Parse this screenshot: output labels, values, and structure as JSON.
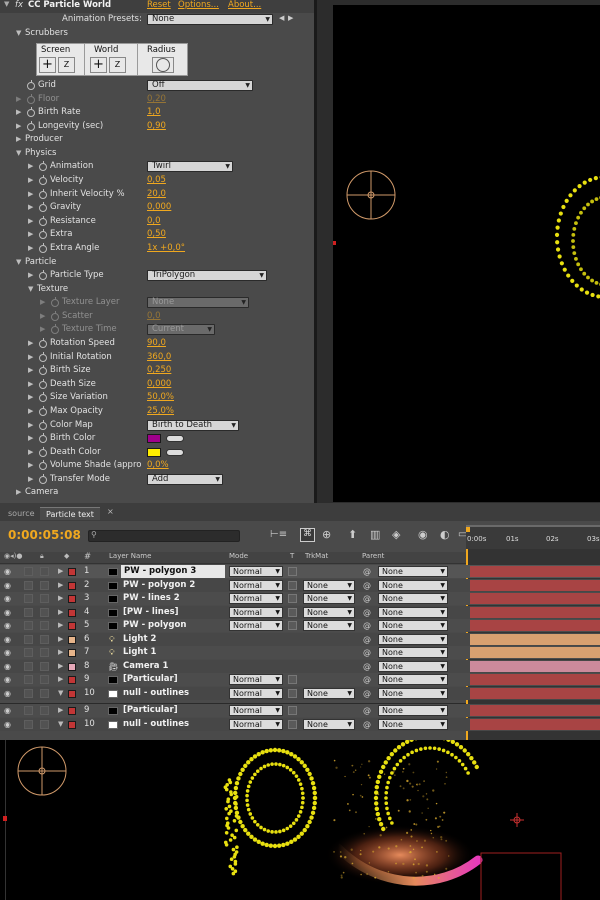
{
  "effect": {
    "fx_badge": "fx",
    "name": "CC Particle World",
    "links": [
      "Reset",
      "Options...",
      "About..."
    ],
    "presets_label": "Animation Presets:",
    "presets_value": "None"
  },
  "scrubbers": {
    "label": "Scrubbers",
    "screen": "Screen",
    "world": "World",
    "radius": "Radius",
    "z": "Z"
  },
  "properties": [
    {
      "label": "Grid",
      "kind": "dd",
      "value": "Off",
      "indent": 0
    },
    {
      "label": "Floor",
      "kind": "val",
      "value": "0,20",
      "indent": 0,
      "dim": true
    },
    {
      "label": "Birth Rate",
      "kind": "val",
      "value": "1,0",
      "indent": 0
    },
    {
      "label": "Longevity (sec)",
      "kind": "val",
      "value": "0,90",
      "indent": 0
    },
    {
      "label": "Producer",
      "kind": "group",
      "indent": 0
    },
    {
      "label": "Physics",
      "kind": "group",
      "indent": 0,
      "open": true
    },
    {
      "label": "Animation",
      "kind": "dd",
      "value": "Twirl",
      "indent": 1
    },
    {
      "label": "Velocity",
      "kind": "val",
      "value": "0,05",
      "indent": 1
    },
    {
      "label": "Inherit Velocity %",
      "kind": "val",
      "value": "20,0",
      "indent": 1
    },
    {
      "label": "Gravity",
      "kind": "val",
      "value": "0,000",
      "indent": 1
    },
    {
      "label": "Resistance",
      "kind": "val",
      "value": "0,0",
      "indent": 1
    },
    {
      "label": "Extra",
      "kind": "val",
      "value": "0,50",
      "indent": 1
    },
    {
      "label": "Extra Angle",
      "kind": "val",
      "value": "1x +0,0°",
      "indent": 1
    },
    {
      "label": "Particle",
      "kind": "group",
      "indent": 0,
      "open": true
    },
    {
      "label": "Particle Type",
      "kind": "dd",
      "value": "TriPolygon",
      "indent": 1
    },
    {
      "label": "Texture",
      "kind": "group",
      "indent": 1,
      "open": true
    },
    {
      "label": "Texture Layer",
      "kind": "dd",
      "value": "None",
      "indent": 2,
      "dim": true
    },
    {
      "label": "Scatter",
      "kind": "val",
      "value": "0,0",
      "indent": 2,
      "dim": true
    },
    {
      "label": "Texture Time",
      "kind": "dd",
      "value": "Current",
      "indent": 2,
      "dim": true
    },
    {
      "label": "Rotation Speed",
      "kind": "val",
      "value": "90,0",
      "indent": 1
    },
    {
      "label": "Initial Rotation",
      "kind": "val",
      "value": "360,0",
      "indent": 1
    },
    {
      "label": "Birth Size",
      "kind": "val",
      "value": "0,250",
      "indent": 1
    },
    {
      "label": "Death Size",
      "kind": "val",
      "value": "0,000",
      "indent": 1
    },
    {
      "label": "Size Variation",
      "kind": "val",
      "value": "50,0%",
      "indent": 1
    },
    {
      "label": "Max Opacity",
      "kind": "val",
      "value": "25,0%",
      "indent": 1
    },
    {
      "label": "Color Map",
      "kind": "dd",
      "value": "Birth to Death",
      "indent": 1
    },
    {
      "label": "Birth Color",
      "kind": "color",
      "value": "#a0008c",
      "indent": 1
    },
    {
      "label": "Death Color",
      "kind": "color",
      "value": "#ffee00",
      "indent": 1
    },
    {
      "label": "Volume Shade (appro",
      "kind": "val",
      "value": "0,0%",
      "indent": 1
    },
    {
      "label": "Transfer Mode",
      "kind": "dd",
      "value": "Add",
      "indent": 1
    },
    {
      "label": "Camera",
      "kind": "group",
      "indent": 0
    }
  ],
  "timeline": {
    "tabs": [
      "source",
      "Particle text"
    ],
    "timecode": "0:00:05:08",
    "headers": {
      "num": "#",
      "layer": "Layer Name",
      "mode": "Mode",
      "t": "T",
      "trkmat": "TrkMat",
      "parent": "Parent"
    },
    "ruler": [
      "0:00s",
      "01s",
      "02s",
      "03s"
    ],
    "layers": [
      {
        "num": "1",
        "name": "PW - polygon 3",
        "mode": "Normal",
        "trkmat": "",
        "parent": "None",
        "label": "#c23636",
        "swatch": "#000000",
        "bar": "#a84444",
        "selected": true
      },
      {
        "num": "2",
        "name": "PW - polygon 2",
        "mode": "Normal",
        "trkmat": "None",
        "parent": "None",
        "label": "#c23636",
        "swatch": "#000000",
        "bar": "#a84444"
      },
      {
        "num": "3",
        "name": "PW - lines 2",
        "mode": "Normal",
        "trkmat": "None",
        "parent": "None",
        "label": "#c23636",
        "swatch": "#000000",
        "bar": "#a84444"
      },
      {
        "num": "4",
        "name": "[PW - lines]",
        "mode": "Normal",
        "trkmat": "None",
        "parent": "None",
        "label": "#c23636",
        "swatch": "#000000",
        "bar": "#a84444"
      },
      {
        "num": "5",
        "name": "PW - polygon",
        "mode": "Normal",
        "trkmat": "None",
        "parent": "None",
        "label": "#c23636",
        "swatch": "#000000",
        "bar": "#a84444"
      },
      {
        "num": "6",
        "name": "Light 2",
        "mode": "",
        "trkmat": "",
        "parent": "None",
        "label": "#e6b48a",
        "swatch": "light",
        "bar": "#d8a070"
      },
      {
        "num": "7",
        "name": "Light 1",
        "mode": "",
        "trkmat": "",
        "parent": "None",
        "label": "#e6b48a",
        "swatch": "light",
        "bar": "#d8a070"
      },
      {
        "num": "8",
        "name": "Camera 1",
        "mode": "",
        "trkmat": "",
        "parent": "None",
        "label": "#e6a8b8",
        "swatch": "camera",
        "bar": "#cc8a9c"
      },
      {
        "num": "9",
        "name": "[Particular]",
        "mode": "Normal",
        "trkmat": "",
        "parent": "None",
        "label": "#c23636",
        "swatch": "#000000",
        "bar": "#a84444"
      },
      {
        "num": "10",
        "name": "null - outlines",
        "mode": "Normal",
        "trkmat": "None",
        "parent": "None",
        "label": "#c23636",
        "swatch": "#ffffff",
        "bar": "#a84444"
      },
      {
        "num": "9",
        "name": "[Particular]",
        "mode": "Normal",
        "trkmat": "",
        "parent": "None",
        "label": "#c23636",
        "swatch": "#000000",
        "bar": "#a84444"
      },
      {
        "num": "10",
        "name": "null - outlines",
        "mode": "Normal",
        "trkmat": "None",
        "parent": "None",
        "label": "#c23636",
        "swatch": "#ffffff",
        "bar": "#a84444"
      }
    ]
  },
  "colors": {
    "accent": "#f0a81f",
    "panel": "#4a4a4a",
    "particles": "#e8e010"
  }
}
